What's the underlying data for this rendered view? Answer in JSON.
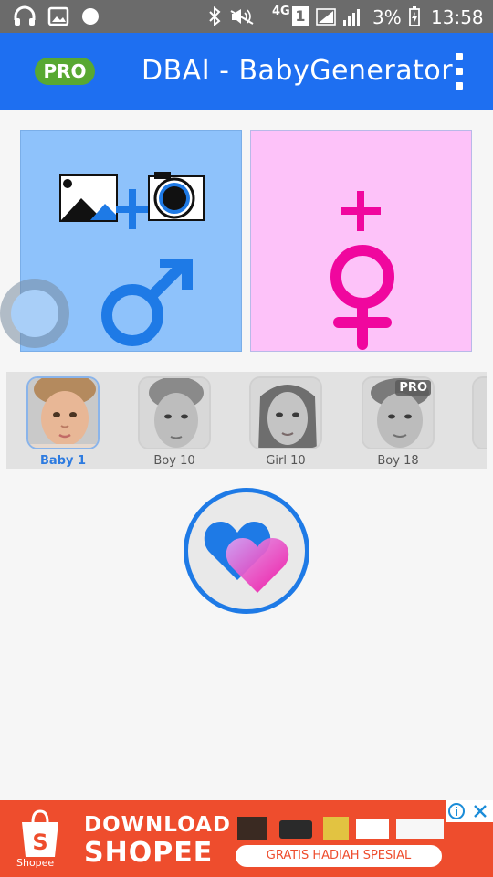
{
  "status_bar": {
    "network": "4G",
    "sim": "1",
    "battery": "3%",
    "time": "13:58"
  },
  "app_bar": {
    "pro_badge": "PRO",
    "title": "DBAI - BabyGenerator"
  },
  "parents": {
    "father_tile": {
      "symbol": "male-symbol-icon",
      "color": "#8ec2fb"
    },
    "mother_tile": {
      "symbol": "female-symbol-icon",
      "color": "#fdc2f9"
    }
  },
  "models": [
    {
      "label": "Baby 1",
      "selected": true,
      "pro": ""
    },
    {
      "label": "Boy 10",
      "selected": false,
      "pro": ""
    },
    {
      "label": "Girl 10",
      "selected": false,
      "pro": ""
    },
    {
      "label": "Boy 18",
      "selected": false,
      "pro": "PRO"
    }
  ],
  "generate": {
    "icon": "hearts-icon"
  },
  "ad": {
    "brand": "Shopee",
    "line1": "DOWNLOAD",
    "line2": "SHOPEE",
    "cta": "GRATIS HADIAH SPESIAL",
    "brand_color": "#ee4d2d"
  },
  "colors": {
    "app_bar": "#1e6ff1",
    "pro_green": "#58a832",
    "male_blue": "#1e7ae6",
    "female_pink": "#f0079e"
  }
}
